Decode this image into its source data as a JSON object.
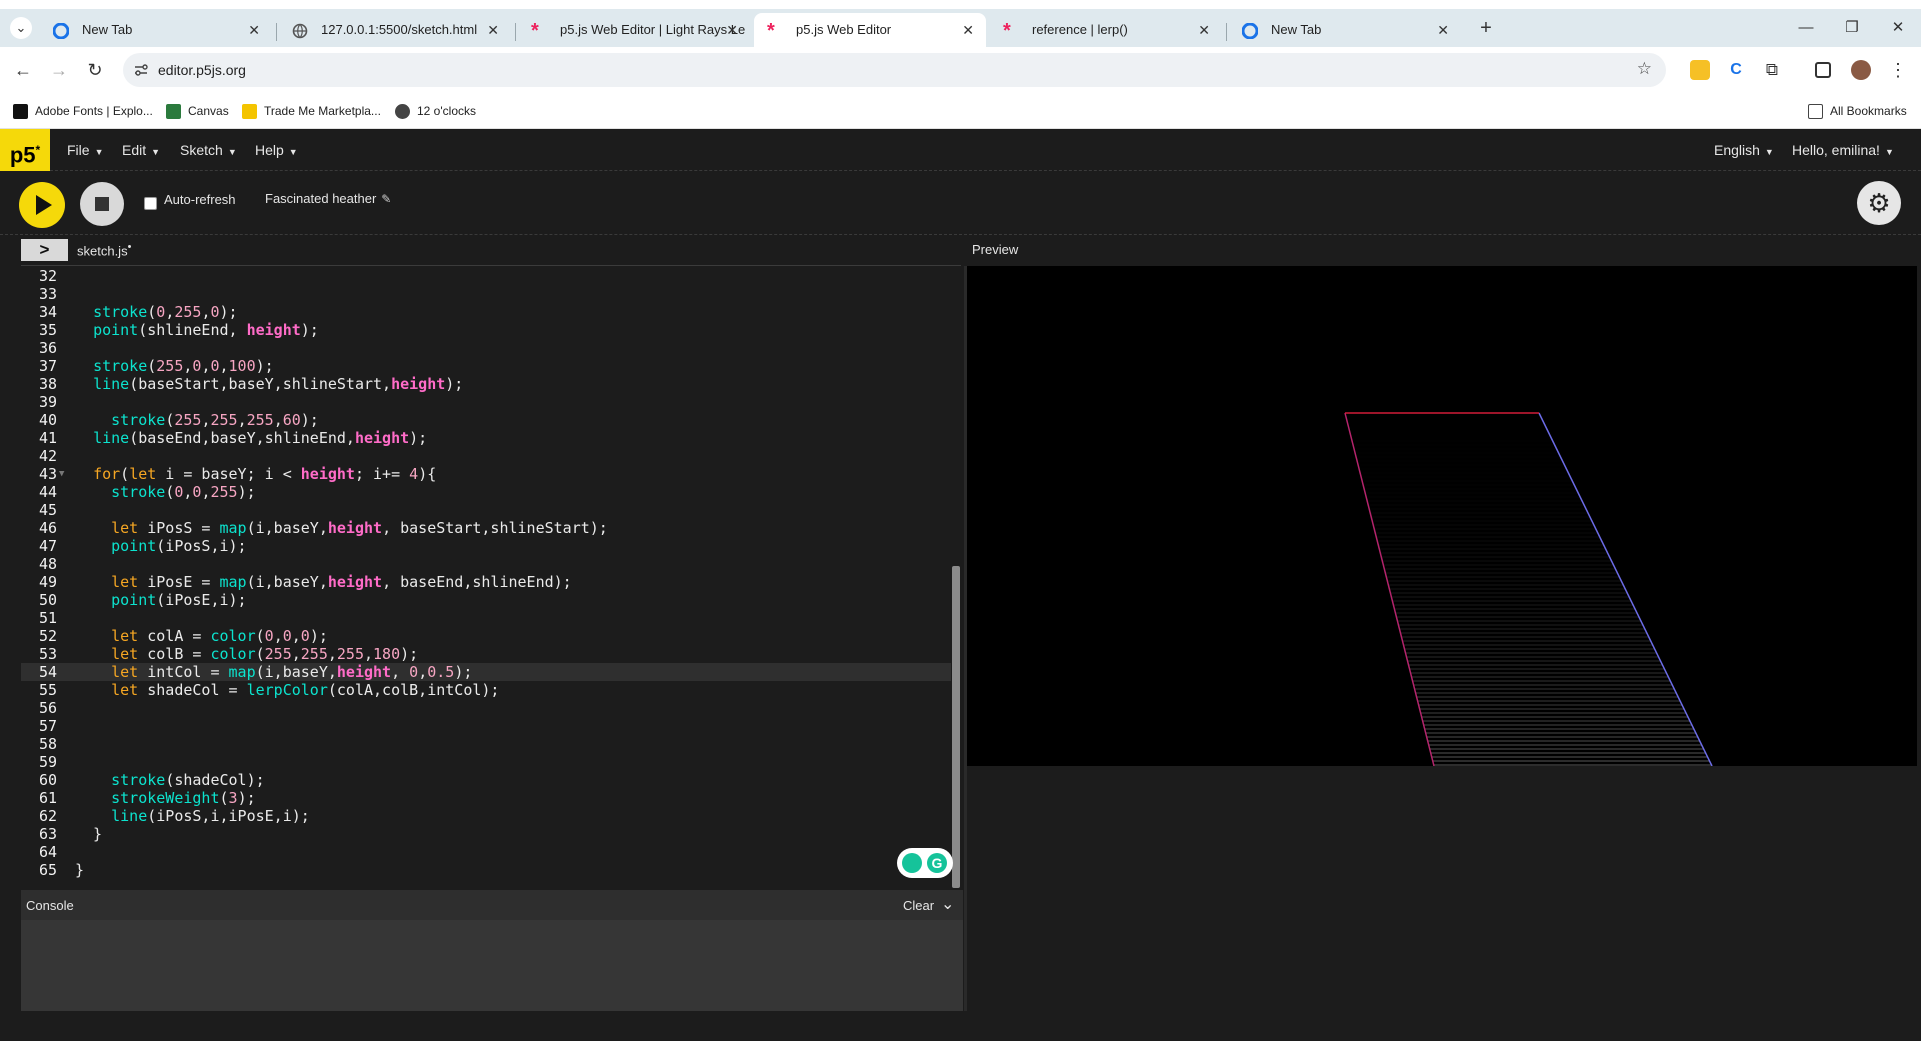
{
  "browser": {
    "tabs": [
      {
        "title": "New Tab",
        "active": false
      },
      {
        "title": "127.0.0.1:5500/sketch.html",
        "active": false
      },
      {
        "title": "p5.js Web Editor | Light Rays Le",
        "active": false
      },
      {
        "title": "p5.js Web Editor",
        "active": true
      },
      {
        "title": "reference | lerp()",
        "active": false
      },
      {
        "title": "New Tab",
        "active": false
      }
    ],
    "url": "editor.p5js.org",
    "bookmarks": [
      {
        "label": "Adobe Fonts | Explo..."
      },
      {
        "label": "Canvas"
      },
      {
        "label": "Trade Me Marketpla..."
      },
      {
        "label": "12 o'clocks"
      }
    ],
    "all_bookmarks_label": "All Bookmarks"
  },
  "p5": {
    "logo": "p5",
    "logo_sup": "*",
    "menus": [
      "File",
      "Edit",
      "Sketch",
      "Help"
    ],
    "language": "English",
    "user_greeting": "Hello, emilina!",
    "autorefresh_label": "Auto-refresh",
    "sketch_name": "Fascinated heather",
    "file_tab": "sketch.js",
    "file_modified_marker": "•",
    "preview_label": "Preview",
    "console_title": "Console",
    "console_clear": "Clear",
    "highlight_line": 54
  },
  "code": [
    {
      "n": "32",
      "tokens": []
    },
    {
      "n": "33",
      "tokens": []
    },
    {
      "n": "34",
      "tokens": [
        [
          "d",
          "  "
        ],
        [
          "f",
          "stroke"
        ],
        [
          "d",
          "("
        ],
        [
          "n",
          "0"
        ],
        [
          "d",
          ","
        ],
        [
          "n",
          "255"
        ],
        [
          "d",
          ","
        ],
        [
          "n",
          "0"
        ],
        [
          "d",
          ");"
        ]
      ]
    },
    {
      "n": "35",
      "tokens": [
        [
          "d",
          "  "
        ],
        [
          "f",
          "point"
        ],
        [
          "d",
          "(shlineEnd, "
        ],
        [
          "b",
          "height"
        ],
        [
          "d",
          ");"
        ]
      ]
    },
    {
      "n": "36",
      "tokens": []
    },
    {
      "n": "37",
      "tokens": [
        [
          "d",
          "  "
        ],
        [
          "f",
          "stroke"
        ],
        [
          "d",
          "("
        ],
        [
          "n",
          "255"
        ],
        [
          "d",
          ","
        ],
        [
          "n",
          "0"
        ],
        [
          "d",
          ","
        ],
        [
          "n",
          "0"
        ],
        [
          "d",
          ","
        ],
        [
          "n",
          "100"
        ],
        [
          "d",
          ");"
        ]
      ]
    },
    {
      "n": "38",
      "tokens": [
        [
          "d",
          "  "
        ],
        [
          "f",
          "line"
        ],
        [
          "d",
          "(baseStart,baseY,shlineStart,"
        ],
        [
          "b",
          "height"
        ],
        [
          "d",
          ");"
        ]
      ]
    },
    {
      "n": "39",
      "tokens": []
    },
    {
      "n": "40",
      "tokens": [
        [
          "d",
          "    "
        ],
        [
          "f",
          "stroke"
        ],
        [
          "d",
          "("
        ],
        [
          "n",
          "255"
        ],
        [
          "d",
          ","
        ],
        [
          "n",
          "255"
        ],
        [
          "d",
          ","
        ],
        [
          "n",
          "255"
        ],
        [
          "d",
          ","
        ],
        [
          "n",
          "60"
        ],
        [
          "d",
          ");"
        ]
      ]
    },
    {
      "n": "41",
      "tokens": [
        [
          "d",
          "  "
        ],
        [
          "f",
          "line"
        ],
        [
          "d",
          "(baseEnd,baseY,shlineEnd,"
        ],
        [
          "b",
          "height"
        ],
        [
          "d",
          ");"
        ]
      ]
    },
    {
      "n": "42",
      "tokens": []
    },
    {
      "n": "43",
      "tokens": [
        [
          "d",
          "  "
        ],
        [
          "k",
          "for"
        ],
        [
          "d",
          "("
        ],
        [
          "k",
          "let"
        ],
        [
          "d",
          " i = baseY; i < "
        ],
        [
          "b",
          "height"
        ],
        [
          "d",
          "; i+= "
        ],
        [
          "n",
          "4"
        ],
        [
          "d",
          "){"
        ]
      ],
      "fold": true
    },
    {
      "n": "44",
      "tokens": [
        [
          "d",
          "    "
        ],
        [
          "f",
          "stroke"
        ],
        [
          "d",
          "("
        ],
        [
          "n",
          "0"
        ],
        [
          "d",
          ","
        ],
        [
          "n",
          "0"
        ],
        [
          "d",
          ","
        ],
        [
          "n",
          "255"
        ],
        [
          "d",
          ");"
        ]
      ]
    },
    {
      "n": "45",
      "tokens": []
    },
    {
      "n": "46",
      "tokens": [
        [
          "d",
          "    "
        ],
        [
          "k",
          "let"
        ],
        [
          "d",
          " iPosS = "
        ],
        [
          "f",
          "map"
        ],
        [
          "d",
          "(i,baseY,"
        ],
        [
          "b",
          "height"
        ],
        [
          "d",
          ", baseStart,shlineStart);"
        ]
      ]
    },
    {
      "n": "47",
      "tokens": [
        [
          "d",
          "    "
        ],
        [
          "f",
          "point"
        ],
        [
          "d",
          "(iPosS,i);"
        ]
      ]
    },
    {
      "n": "48",
      "tokens": []
    },
    {
      "n": "49",
      "tokens": [
        [
          "d",
          "    "
        ],
        [
          "k",
          "let"
        ],
        [
          "d",
          " iPosE = "
        ],
        [
          "f",
          "map"
        ],
        [
          "d",
          "(i,baseY,"
        ],
        [
          "b",
          "height"
        ],
        [
          "d",
          ", baseEnd,shlineEnd);"
        ]
      ]
    },
    {
      "n": "50",
      "tokens": [
        [
          "d",
          "    "
        ],
        [
          "f",
          "point"
        ],
        [
          "d",
          "(iPosE,i);"
        ]
      ]
    },
    {
      "n": "51",
      "tokens": []
    },
    {
      "n": "52",
      "tokens": [
        [
          "d",
          "    "
        ],
        [
          "k",
          "let"
        ],
        [
          "d",
          " colA = "
        ],
        [
          "f",
          "color"
        ],
        [
          "d",
          "("
        ],
        [
          "n",
          "0"
        ],
        [
          "d",
          ","
        ],
        [
          "n",
          "0"
        ],
        [
          "d",
          ","
        ],
        [
          "n",
          "0"
        ],
        [
          "d",
          ");"
        ]
      ]
    },
    {
      "n": "53",
      "tokens": [
        [
          "d",
          "    "
        ],
        [
          "k",
          "let"
        ],
        [
          "d",
          " colB = "
        ],
        [
          "f",
          "color"
        ],
        [
          "d",
          "("
        ],
        [
          "n",
          "255"
        ],
        [
          "d",
          ","
        ],
        [
          "n",
          "255"
        ],
        [
          "d",
          ","
        ],
        [
          "n",
          "255"
        ],
        [
          "d",
          ","
        ],
        [
          "n",
          "180"
        ],
        [
          "d",
          ");"
        ]
      ]
    },
    {
      "n": "54",
      "tokens": [
        [
          "d",
          "    "
        ],
        [
          "k",
          "let"
        ],
        [
          "d",
          " intCol = "
        ],
        [
          "f",
          "map"
        ],
        [
          "d",
          "(i,baseY,"
        ],
        [
          "b",
          "height"
        ],
        [
          "d",
          ", "
        ],
        [
          "n",
          "0"
        ],
        [
          "d",
          ","
        ],
        [
          "n",
          "0.5"
        ],
        [
          "d",
          ");"
        ]
      ]
    },
    {
      "n": "55",
      "tokens": [
        [
          "d",
          "    "
        ],
        [
          "k",
          "let"
        ],
        [
          "d",
          " shadeCol = "
        ],
        [
          "f",
          "lerpColor"
        ],
        [
          "d",
          "(colA,colB,intCol);"
        ]
      ]
    },
    {
      "n": "56",
      "tokens": []
    },
    {
      "n": "57",
      "tokens": []
    },
    {
      "n": "58",
      "tokens": []
    },
    {
      "n": "59",
      "tokens": []
    },
    {
      "n": "60",
      "tokens": [
        [
          "d",
          "    "
        ],
        [
          "f",
          "stroke"
        ],
        [
          "d",
          "(shadeCol);"
        ]
      ]
    },
    {
      "n": "61",
      "tokens": [
        [
          "d",
          "    "
        ],
        [
          "f",
          "strokeWeight"
        ],
        [
          "d",
          "("
        ],
        [
          "n",
          "3"
        ],
        [
          "d",
          ");"
        ]
      ]
    },
    {
      "n": "62",
      "tokens": [
        [
          "d",
          "    "
        ],
        [
          "f",
          "line"
        ],
        [
          "d",
          "(iPosS,i,iPosE,i);"
        ]
      ]
    },
    {
      "n": "63",
      "tokens": [
        [
          "d",
          "  }"
        ]
      ]
    },
    {
      "n": "64",
      "tokens": []
    },
    {
      "n": "65",
      "tokens": [
        [
          "d",
          "}"
        ]
      ]
    }
  ],
  "colors": {
    "p5_yellow": "#f5d90a",
    "editor_bg": "#1c1c1c",
    "keyword": "#f5a623",
    "function": "#0ce3ce",
    "number": "#f7a6c3",
    "builtin_bold": "#ff6cc8"
  }
}
